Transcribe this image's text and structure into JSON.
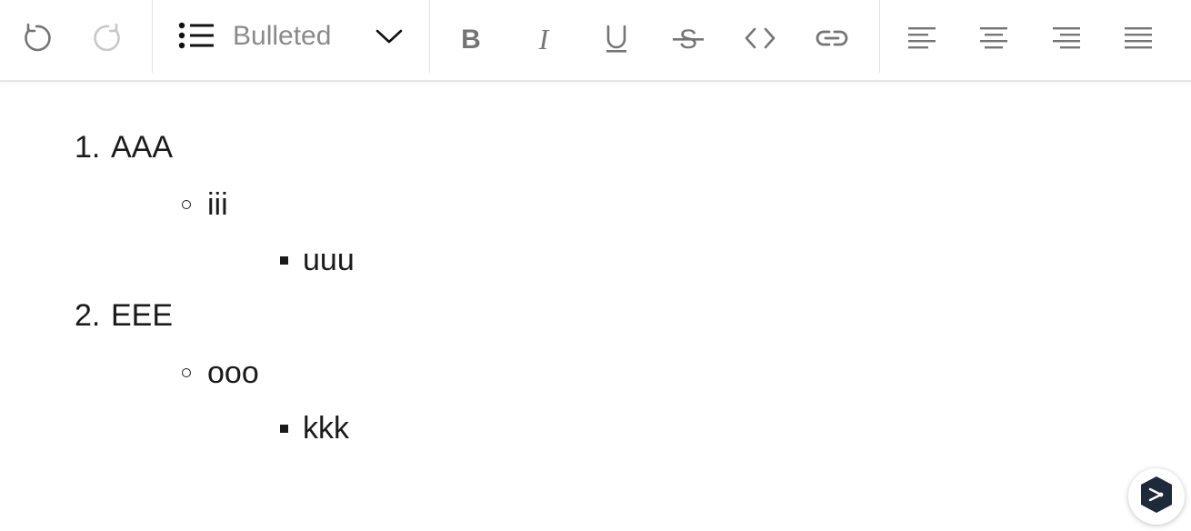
{
  "toolbar": {
    "undo_icon": "undo-icon",
    "redo_icon": "redo-icon",
    "format_select": {
      "icon": "bulleted-list-icon",
      "selected_value": "Bulleted",
      "chevron_icon": "chevron-down-icon"
    },
    "formatting_buttons": [
      "bold-icon",
      "italic-icon",
      "underline-icon",
      "strikethrough-icon",
      "code-icon",
      "link-icon"
    ],
    "alignment_buttons": [
      "align-left-icon",
      "align-center-icon",
      "align-right-icon",
      "align-justify-icon"
    ],
    "colors": {
      "icon_active": "#757575",
      "icon_disabled": "#c8c8c8",
      "icon_black": "#111111",
      "separator": "#e3e3e3"
    }
  },
  "editor": {
    "list": [
      {
        "marker": "1.",
        "text": "AAA",
        "children": [
          {
            "text": "iii",
            "children": [
              {
                "text": "uuu"
              }
            ]
          }
        ]
      },
      {
        "marker": "2.",
        "text": "EEE",
        "children": [
          {
            "text": "ooo",
            "children": [
              {
                "text": "kkk"
              }
            ]
          }
        ]
      }
    ]
  },
  "assistant_button": {
    "icon": "assistant-logo-icon",
    "color": "#1e2a3a"
  }
}
